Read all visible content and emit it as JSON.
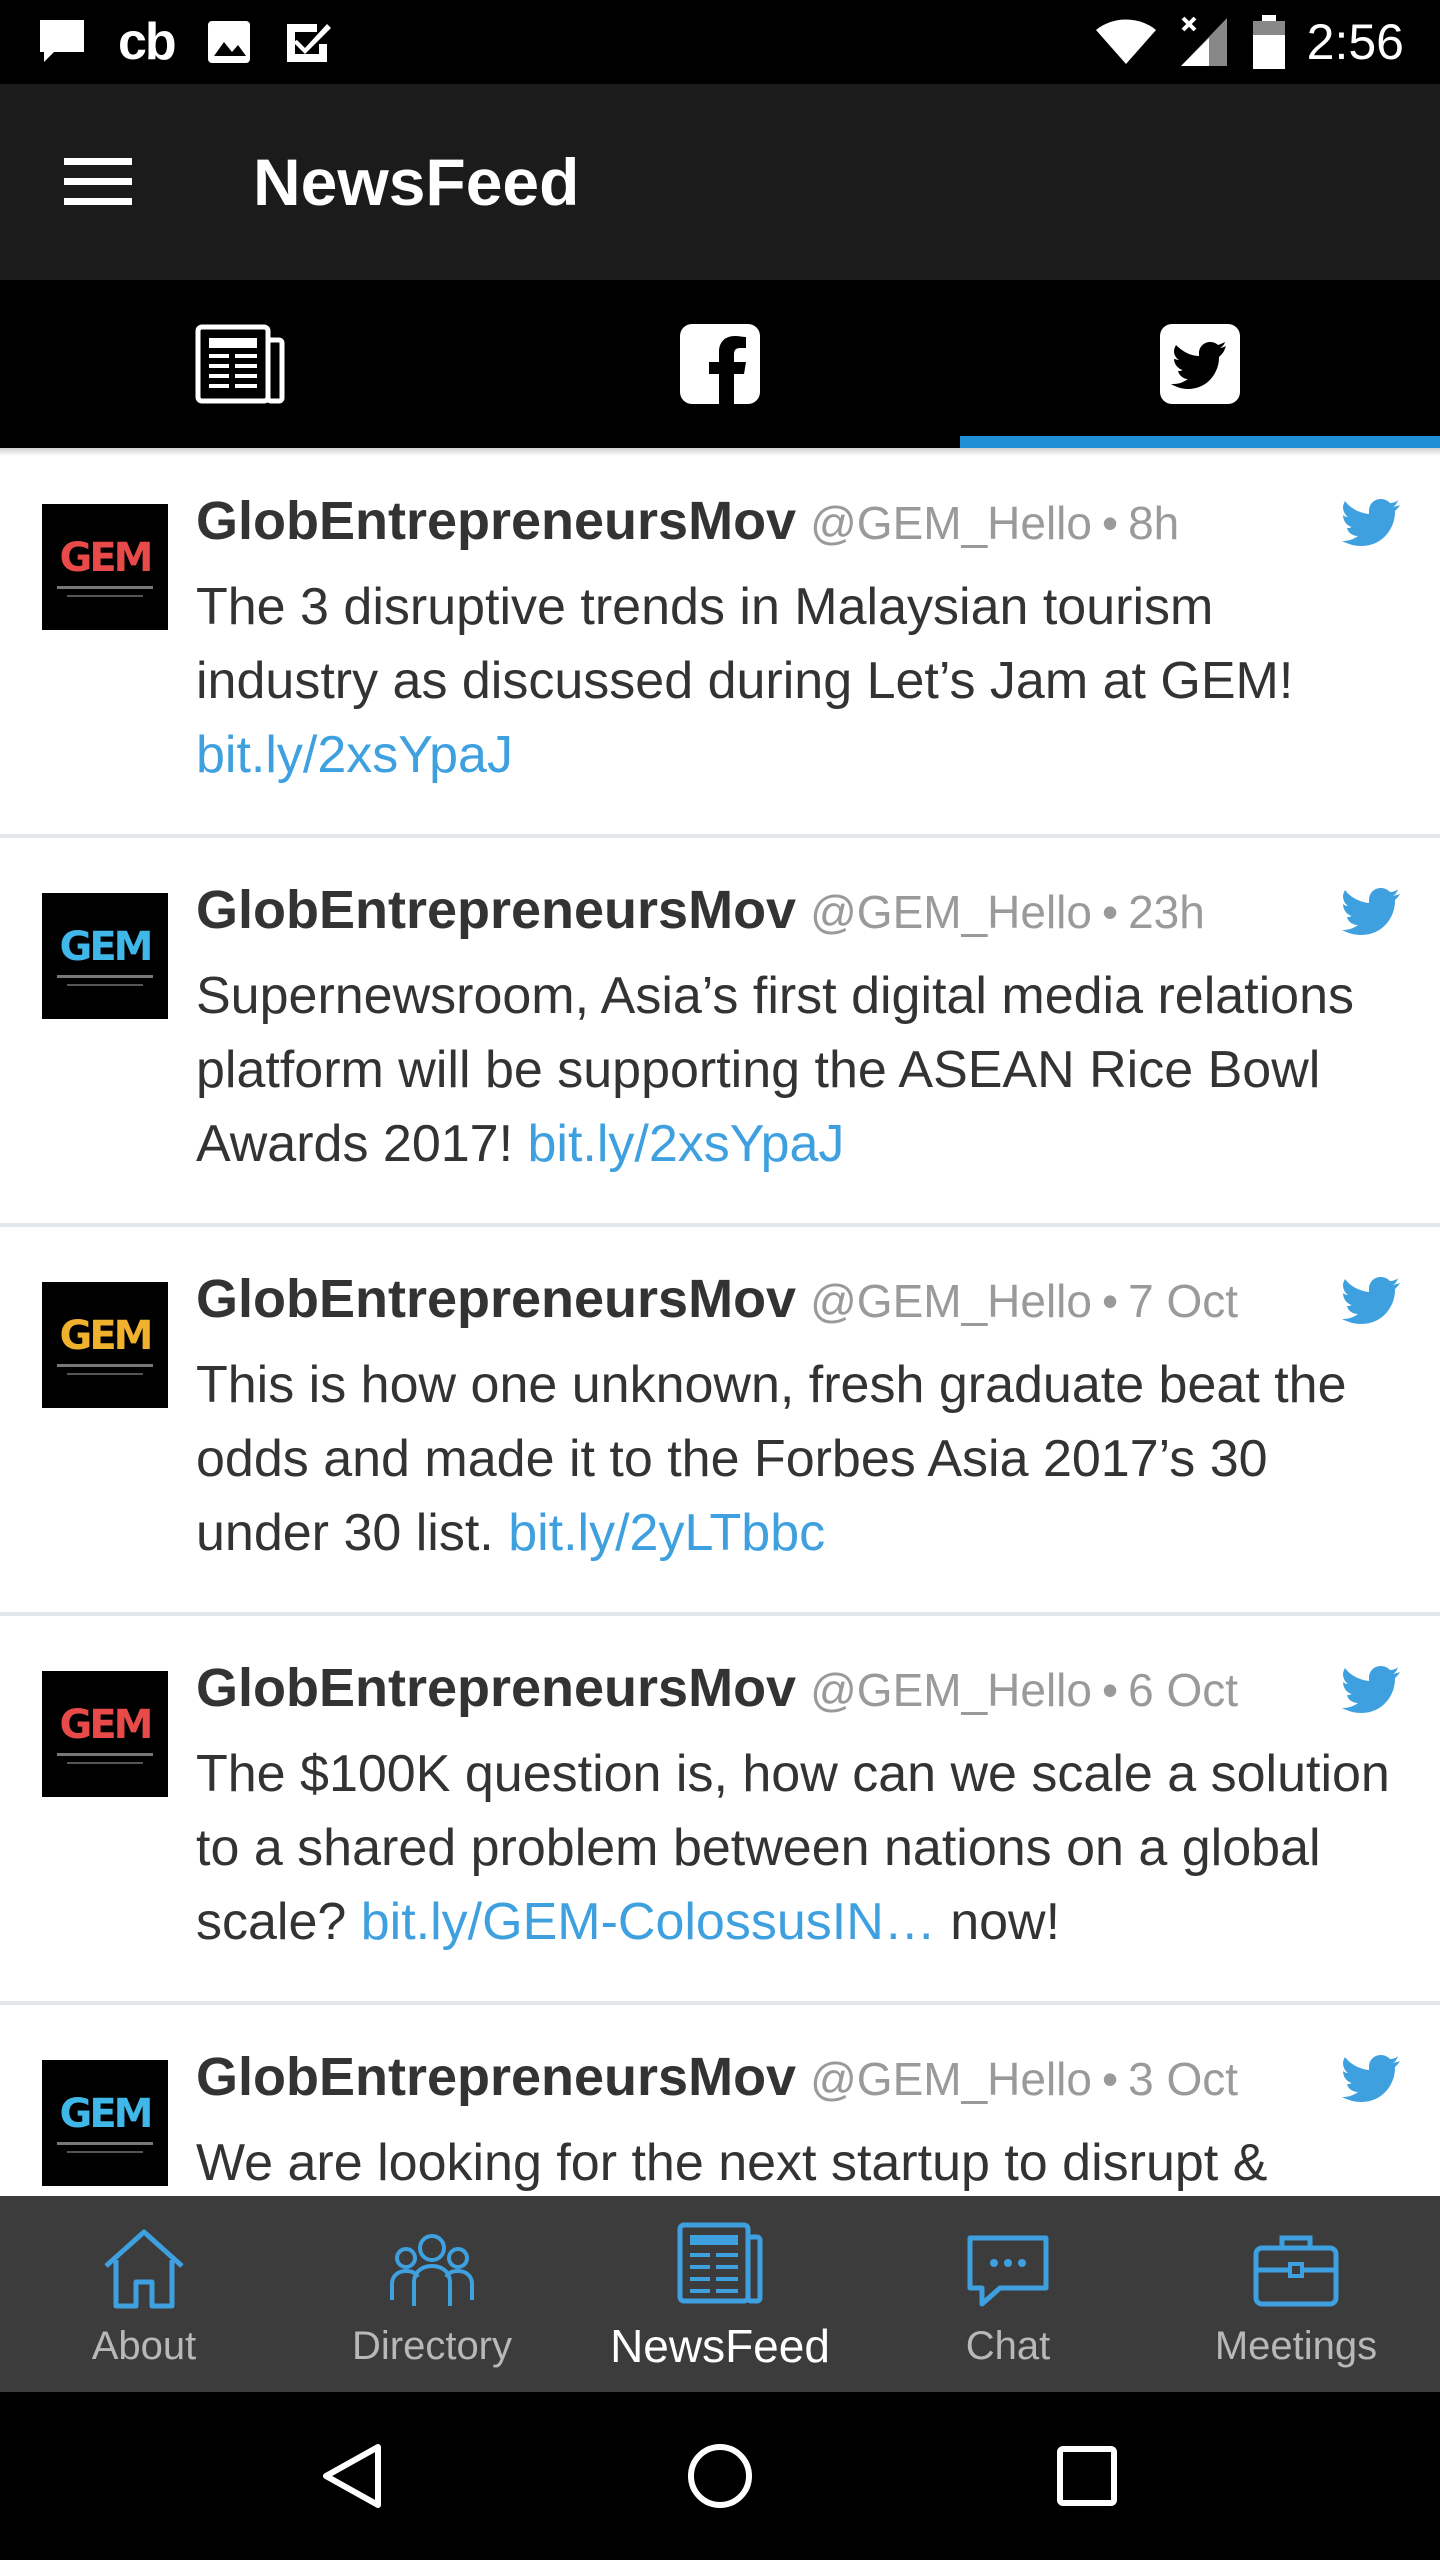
{
  "status_bar": {
    "time": "2:56",
    "left_icons": [
      "message-icon",
      "cb-icon",
      "image-icon",
      "checkbox-icon"
    ],
    "right_icons": [
      "wifi-icon",
      "signal-icon",
      "battery-icon"
    ],
    "cb_text": "cb"
  },
  "app_bar": {
    "title": "NewsFeed",
    "menu_icon": "hamburger-menu-icon"
  },
  "tabs": [
    {
      "icon": "news-icon",
      "active": false
    },
    {
      "icon": "facebook-icon",
      "active": false
    },
    {
      "icon": "twitter-icon",
      "active": true
    }
  ],
  "tweets": [
    {
      "author": "GlobEntrepreneursMov",
      "handle": "@GEM_Hello",
      "time": "8h",
      "text": "The 3 disruptive trends in Malaysian tourism industry as discussed during Let’s Jam at GEM!",
      "link": "bit.ly/2xsYpaJ",
      "suffix": ""
    },
    {
      "author": "GlobEntrepreneursMov",
      "handle": "@GEM_Hello",
      "time": "23h",
      "text": "Supernewsroom, Asia’s first digital media relations platform will be supporting the ASEAN Rice Bowl Awards 2017!",
      "link": "bit.ly/2xsYpaJ",
      "suffix": ""
    },
    {
      "author": "GlobEntrepreneursMov",
      "handle": "@GEM_Hello",
      "time": "7 Oct",
      "text": "This is how one unknown, fresh graduate beat the odds and made it to the Forbes Asia 2017’s 30 under 30 list.",
      "link": "bit.ly/2yLTbbc",
      "suffix": ""
    },
    {
      "author": "GlobEntrepreneursMov",
      "handle": "@GEM_Hello",
      "time": "6 Oct",
      "text": "The $100K question is, how can we scale a solution to a shared problem between nations on a global scale?",
      "link": "bit.ly/GEM-ColossusIN…",
      "suffix": "now!"
    },
    {
      "author": "GlobEntrepreneursMov",
      "handle": "@GEM_Hello",
      "time": "3 Oct",
      "text": "We are looking for the next startup to disrupt &",
      "link": "",
      "suffix": ""
    }
  ],
  "avatar_text": "GEM",
  "bottom_nav": [
    {
      "label": "About",
      "icon": "home-icon",
      "active": false
    },
    {
      "label": "Directory",
      "icon": "people-icon",
      "active": false
    },
    {
      "label": "NewsFeed",
      "icon": "news-icon",
      "active": true
    },
    {
      "label": "Chat",
      "icon": "chat-icon",
      "active": false
    },
    {
      "label": "Meetings",
      "icon": "briefcase-icon",
      "active": false
    }
  ],
  "system_nav": [
    "back-icon",
    "home-circle-icon",
    "recents-icon"
  ],
  "colors": {
    "accent": "#1f8fd6",
    "link": "#3fa0e0",
    "app_bar": "#1b1b1b",
    "bottom_nav": "#3c3c3c",
    "twitter_blue": "#3fa0e0"
  }
}
